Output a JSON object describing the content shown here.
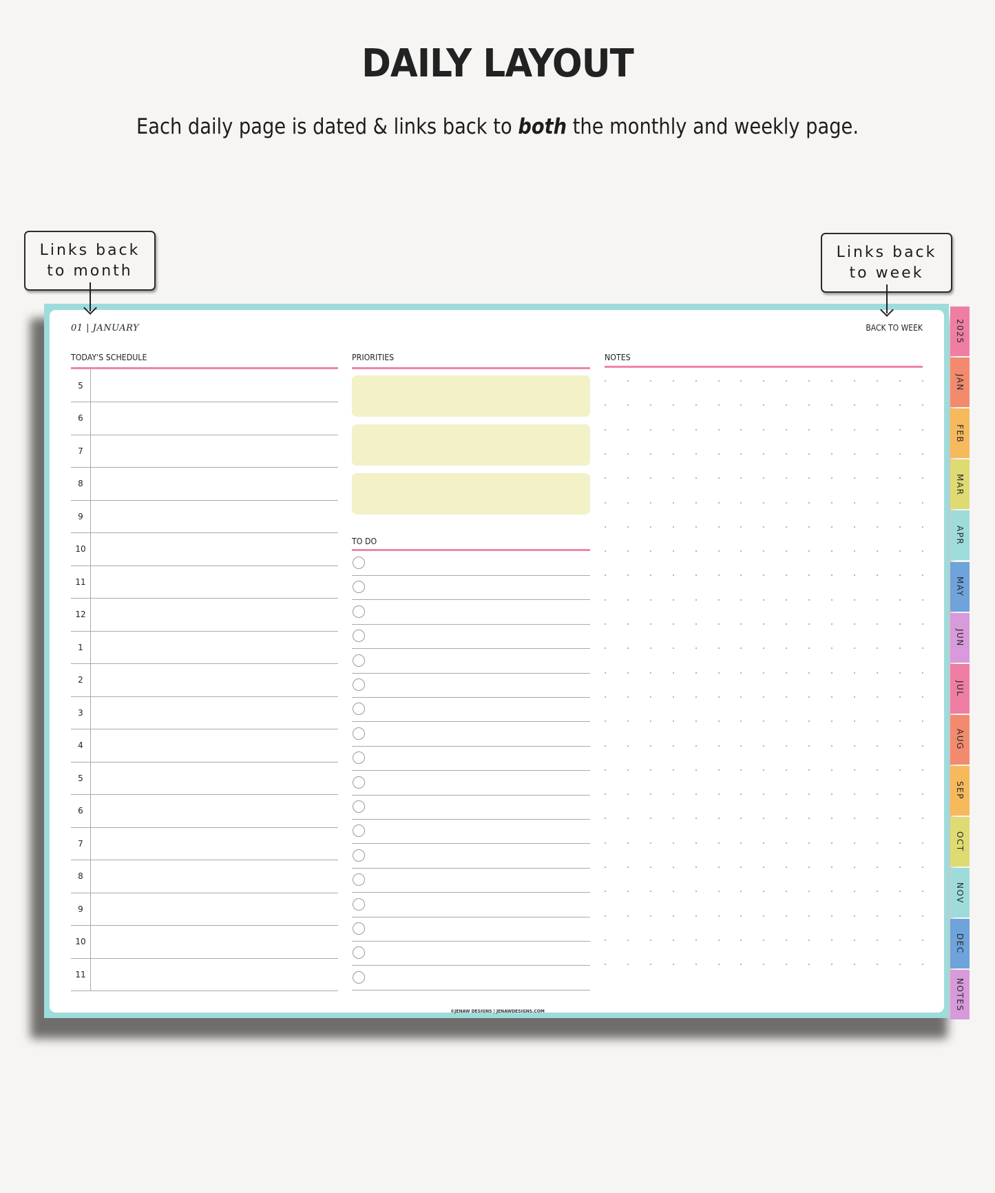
{
  "header": {
    "title": "DAILY LAYOUT",
    "subtitle_before": "Each daily page is dated & links back to ",
    "subtitle_emphasis": "both",
    "subtitle_after": " the monthly and weekly page."
  },
  "callouts": {
    "month": {
      "line1": "Links back",
      "line2": "to month"
    },
    "week": {
      "line1": "Links back",
      "line2": "to week"
    }
  },
  "planner": {
    "date_label": "01 | JANUARY",
    "back_to_week": "BACK TO WEEK",
    "schedule": {
      "heading": "TODAY'S SCHEDULE",
      "hours": [
        "5",
        "6",
        "7",
        "8",
        "9",
        "10",
        "11",
        "12",
        "1",
        "2",
        "3",
        "4",
        "5",
        "6",
        "7",
        "8",
        "9",
        "10",
        "11"
      ]
    },
    "priorities": {
      "heading": "PRIORITIES",
      "count": 3
    },
    "todo": {
      "heading": "TO DO",
      "count": 18
    },
    "notes": {
      "heading": "NOTES",
      "dot_columns": 15,
      "dot_rows": 25
    },
    "footer": "©JENAW DESIGNS | JENAWDESIGNS.COM",
    "colors": {
      "frame": "#9edcdc",
      "rule": "#ef86a6",
      "priority_fill": "#f2f1c8"
    },
    "tabs": [
      {
        "label": "2025",
        "color": "#ee7ea3"
      },
      {
        "label": "JAN",
        "color": "#f28a6e"
      },
      {
        "label": "FEB",
        "color": "#f6b95c"
      },
      {
        "label": "MAR",
        "color": "#dedb72"
      },
      {
        "label": "APR",
        "color": "#9edcdc"
      },
      {
        "label": "MAY",
        "color": "#6ea3dc"
      },
      {
        "label": "JUN",
        "color": "#d89ada"
      },
      {
        "label": "JUL",
        "color": "#ee7ea3"
      },
      {
        "label": "AUG",
        "color": "#f28a6e"
      },
      {
        "label": "SEP",
        "color": "#f6b95c"
      },
      {
        "label": "OCT",
        "color": "#dedb72"
      },
      {
        "label": "NOV",
        "color": "#9edcdc"
      },
      {
        "label": "DEC",
        "color": "#6ea3dc"
      },
      {
        "label": "NOTES",
        "color": "#d89ada"
      }
    ]
  }
}
